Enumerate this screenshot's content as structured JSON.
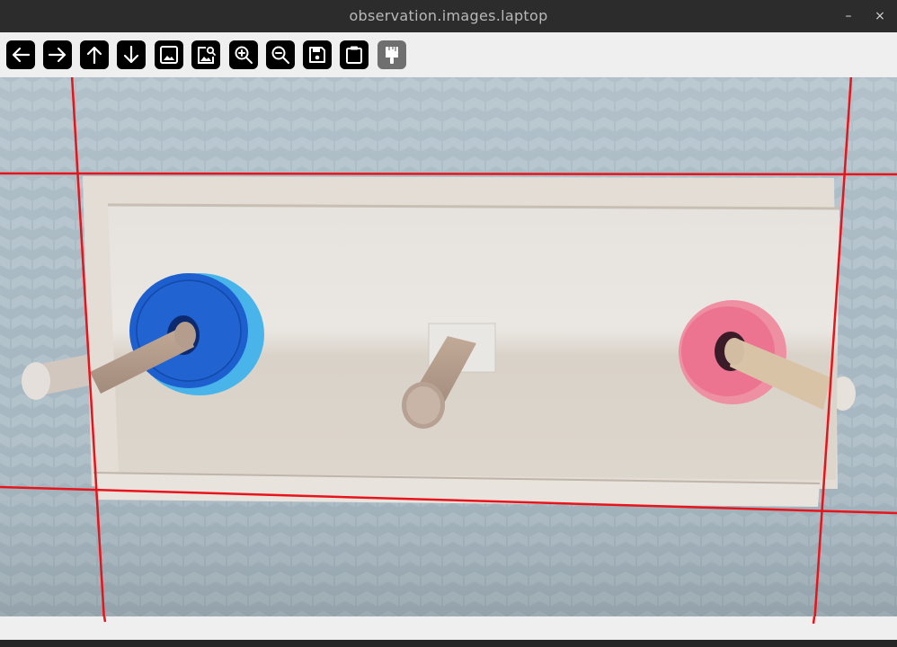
{
  "window": {
    "title": "observation.images.laptop",
    "minimize_label": "–",
    "close_label": "×"
  },
  "toolbar": {
    "buttons": [
      {
        "name": "back-button",
        "icon": "arrow-left-icon"
      },
      {
        "name": "forward-button",
        "icon": "arrow-right-icon"
      },
      {
        "name": "up-button",
        "icon": "arrow-up-icon"
      },
      {
        "name": "down-button",
        "icon": "arrow-down-icon"
      },
      {
        "name": "image-button",
        "icon": "image-icon"
      },
      {
        "name": "image-search-button",
        "icon": "image-search-icon"
      },
      {
        "name": "zoom-in-button",
        "icon": "zoom-in-icon"
      },
      {
        "name": "zoom-out-button",
        "icon": "zoom-out-icon"
      },
      {
        "name": "save-button",
        "icon": "save-icon"
      },
      {
        "name": "clipboard-button",
        "icon": "clipboard-icon"
      },
      {
        "name": "brush-button",
        "icon": "paint-brush-icon",
        "disabled": true
      }
    ]
  },
  "colors": {
    "titlebar": "#2c2c2c",
    "toolbar": "#efefef",
    "button": "#000000",
    "button_disabled": "#6f6f6f",
    "overlay_line": "#e8141b",
    "background_fabric": "#9fb2bd",
    "wood_board": "#ddd6cc",
    "ring_blue_outer": "#3fa7e0",
    "ring_blue_inner": "#1e63c8",
    "ring_pink": "#ee7f95"
  }
}
